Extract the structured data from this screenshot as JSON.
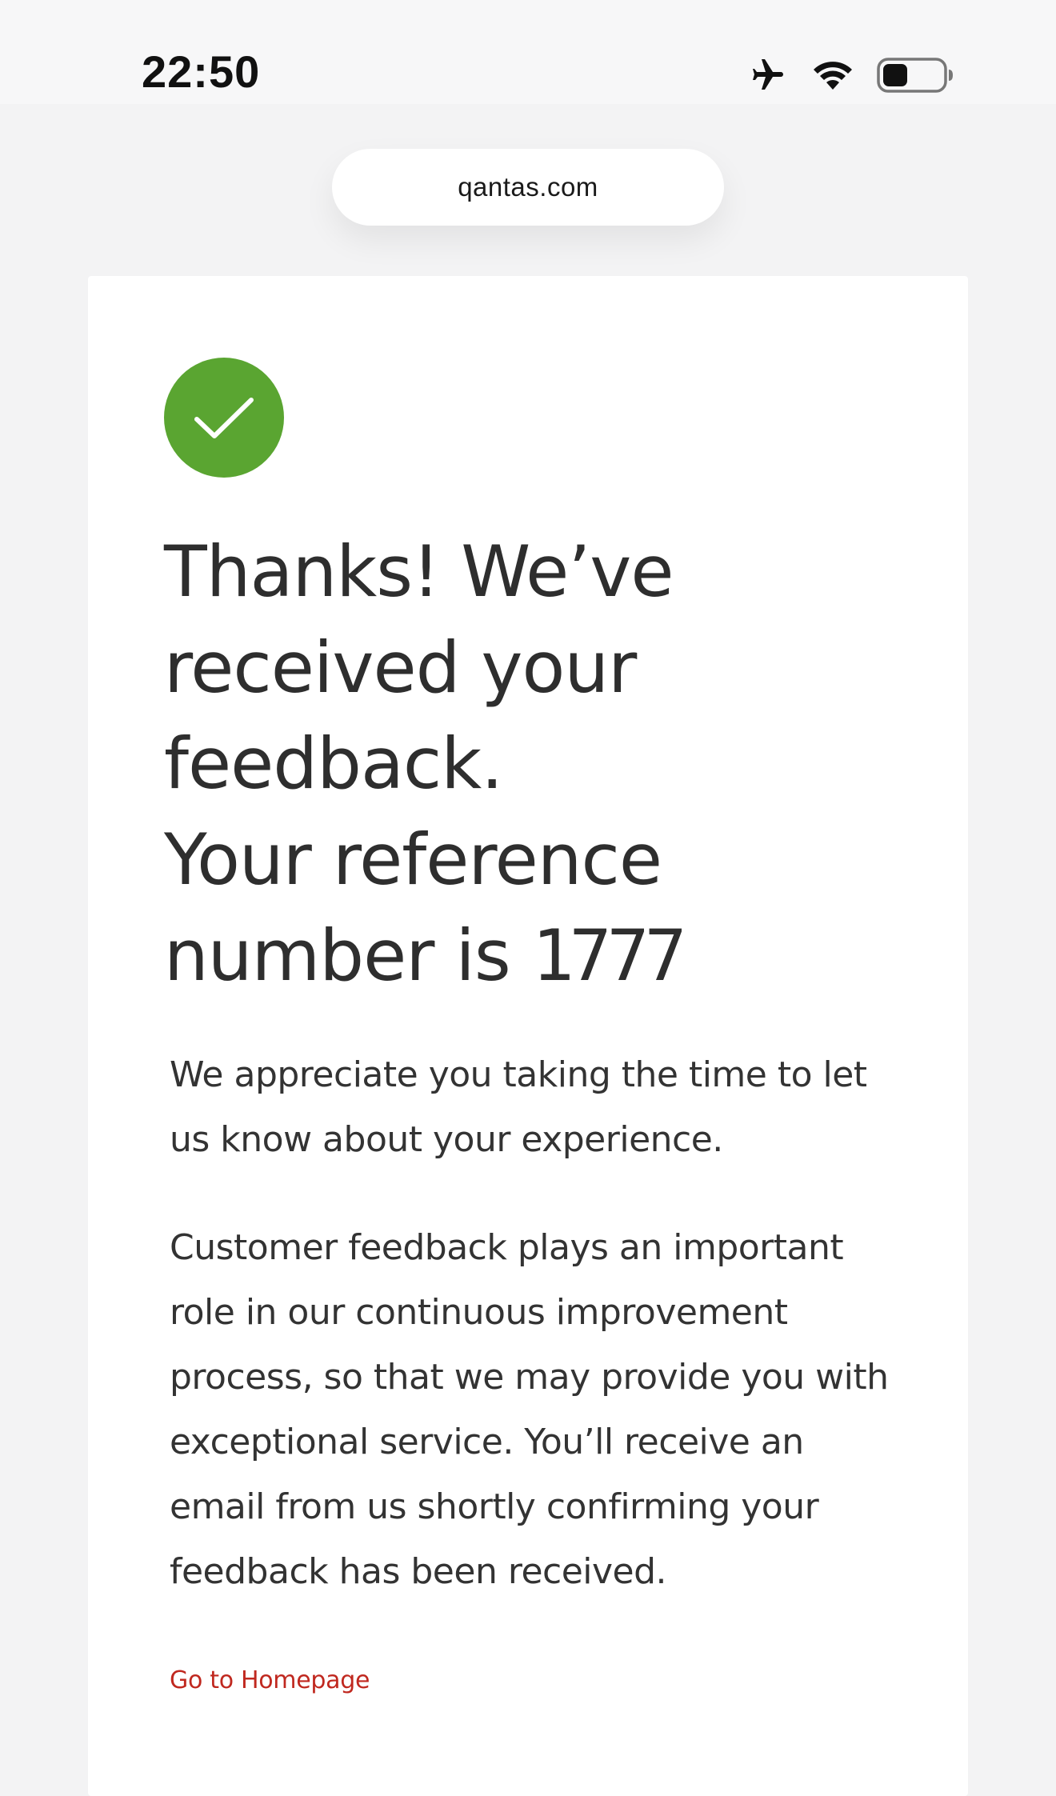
{
  "status_bar": {
    "time": "22:50",
    "icons": [
      "airplane-mode-icon",
      "wifi-icon",
      "battery-icon"
    ]
  },
  "browser": {
    "url": "qantas.com"
  },
  "confirmation": {
    "icon": "checkmark-icon",
    "icon_color": "#5aa531",
    "heading_lines": [
      "Thanks! We’ve",
      "received your",
      "feedback.",
      "Your reference"
    ],
    "heading_last_prefix": "number is ",
    "reference_number": "1777",
    "paragraph_1": "We appreciate you taking the time to let us know about your experience.",
    "paragraph_2": "Customer feedback plays an important role in our continuous improvement process, so that we may provide you with exceptional service. You’ll receive an email from us shortly confirming your feedback has been received.",
    "home_link": "Go to Homepage",
    "link_color": "#c0281f"
  }
}
